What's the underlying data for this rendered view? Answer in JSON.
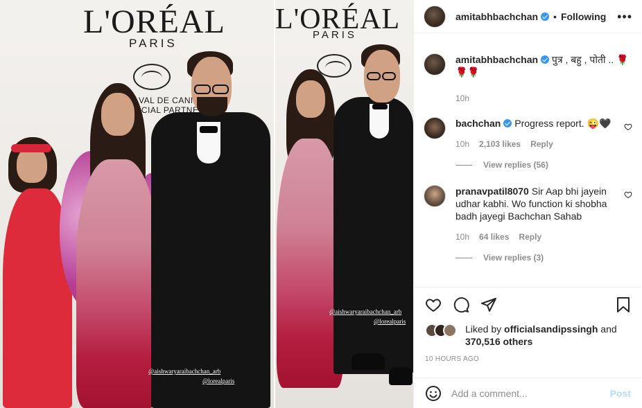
{
  "post": {
    "owner": "amitabhbachchan",
    "follow_status": "Following",
    "caption_user": "amitabhbachchan",
    "caption_text": "पुत्र , बहु , पोती .. 🌹🌹🌹",
    "caption_time": "10h",
    "likes_prefix": "Liked by",
    "likes_user": "officialsandipssingh",
    "likes_and": "and",
    "likes_others": "370,516 others",
    "time_ago": "10 HOURS AGO"
  },
  "media": {
    "brand_logo": "L'ORÉAL",
    "brand_sub": "PARIS",
    "festival_line1": "VAL DE CANNES",
    "festival_line2": "ICIAL PARTNER",
    "tag1": "@aishwaryaraibachchan_arb",
    "tag2": "@lorealparis"
  },
  "comments": [
    {
      "user": "bachchan",
      "verified": true,
      "text": "Progress report. 😜🖤",
      "time": "10h",
      "likes": "2,103 likes",
      "reply_label": "Reply",
      "view_replies": "View replies (56)"
    },
    {
      "user": "pranavpatil8070",
      "verified": false,
      "text": "Sir Aap bhi jayein udhar kabhi. Wo function ki shobha badh jayegi Bachchan Sahab",
      "time": "10h",
      "likes": "64 likes",
      "reply_label": "Reply",
      "view_replies": "View replies (3)"
    }
  ],
  "composer": {
    "placeholder": "Add a comment...",
    "post_label": "Post"
  },
  "icons": {
    "more": "more-options-icon",
    "like": "heart-icon",
    "comment": "comment-icon",
    "share": "share-icon",
    "save": "bookmark-icon",
    "emoji": "emoji-icon"
  },
  "colors": {
    "verified": "#3897f0",
    "secondary_text": "#8e8e8e",
    "post_disabled": "#b2dffc"
  }
}
